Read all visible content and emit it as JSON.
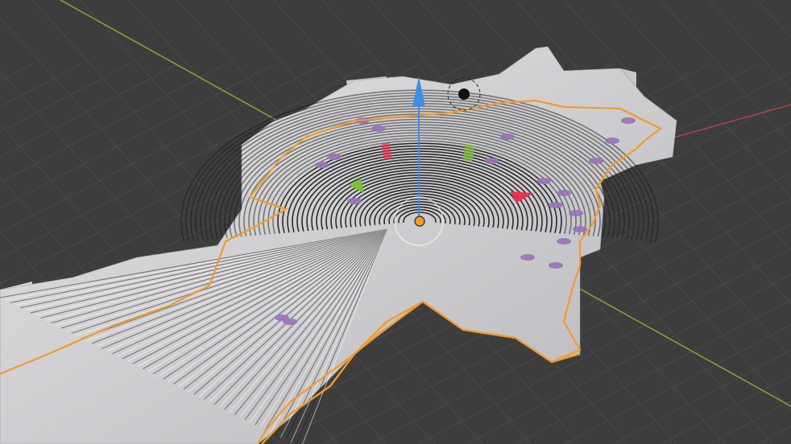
{
  "viewport": {
    "background": "#3d3d3d",
    "grid_color": "#4a4a4a",
    "axis_x_color": "#c0404f",
    "axis_y_color": "#7fa035",
    "selection_outline_color": "#f29b2a",
    "mesh_color": "#c9c9cc",
    "scan_line_color": "#ffffff",
    "scan_gap_color": "#1a1a1a",
    "highlight_color": "#9a72b8"
  },
  "gizmo": {
    "z_arrow": "blue-cone-icon",
    "x_handle": "red-cone-icon",
    "y_handle": "green-cone-icon",
    "origin": "object-origin-icon",
    "view_rotate": "rotate-ring-icon",
    "colors": {
      "z": "#3d8fe6",
      "x": "#e8344e",
      "y": "#7ac22e",
      "origin": "#f29b2a"
    }
  }
}
